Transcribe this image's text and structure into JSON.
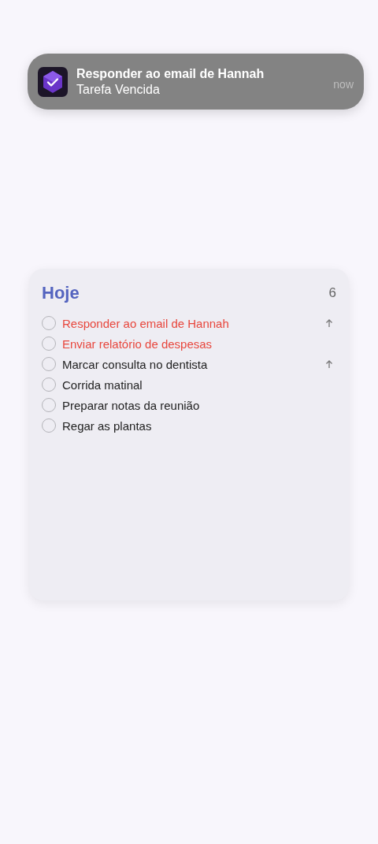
{
  "notification": {
    "title": "Responder ao email de Hannah",
    "body": "Tarefa Vencida",
    "time": "now"
  },
  "widget": {
    "title": "Hoje",
    "count": "6",
    "tasks": [
      {
        "label": "Responder ao email de Hannah",
        "checked": false,
        "overdue": true,
        "priority": true
      },
      {
        "label": "Enviar relatório de despesas",
        "checked": false,
        "overdue": true,
        "priority": false
      },
      {
        "label": "Marcar consulta no dentista",
        "checked": false,
        "overdue": false,
        "priority": true
      },
      {
        "label": "Corrida matinal",
        "checked": false,
        "overdue": false,
        "priority": false
      },
      {
        "label": "Preparar notas da reunião",
        "checked": false,
        "overdue": false,
        "priority": false
      },
      {
        "label": "Regar as plantas",
        "checked": false,
        "overdue": false,
        "priority": false
      }
    ]
  }
}
